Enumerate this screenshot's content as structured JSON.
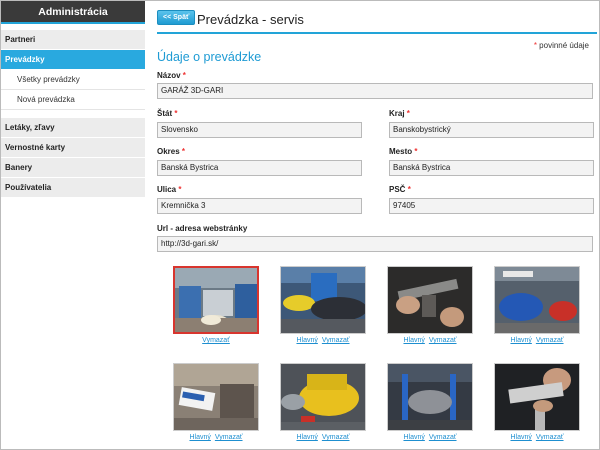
{
  "sidebar": {
    "header": "Administrácia",
    "items": [
      {
        "label": "Partneri"
      },
      {
        "label": "Prevádzky"
      }
    ],
    "subitems": [
      {
        "label": "Všetky prevádzky"
      },
      {
        "label": "Nová prevádzka"
      }
    ],
    "items2": [
      {
        "label": "Letáky, zľavy"
      },
      {
        "label": "Vernostné karty"
      },
      {
        "label": "Banery"
      },
      {
        "label": "Používatelia"
      }
    ]
  },
  "header": {
    "back_label": "<< Späť",
    "title": "Prevádzka - servis"
  },
  "form": {
    "required_star": "*",
    "required_note": "povinné údaje",
    "section_title": "Údaje o prevádzke",
    "nazov_label": "Názov",
    "nazov_value": "GARÁŽ 3D-GARI",
    "stat_label": "Štát",
    "stat_value": "Slovensko",
    "kraj_label": "Kraj",
    "kraj_value": "Banskobystrický",
    "okres_label": "Okres",
    "okres_value": "Banská Bystrica",
    "mesto_label": "Mesto",
    "mesto_value": "Banská Bystrica",
    "ulica_label": "Ulica",
    "ulica_value": "Kremnička 3",
    "psc_label": "PSČ",
    "psc_value": "97405",
    "url_label": "Url - adresa webstránky",
    "url_value": "http://3d-gari.sk/"
  },
  "photos": {
    "main_label": "Hlavný",
    "delete_label": "Vymazať"
  }
}
